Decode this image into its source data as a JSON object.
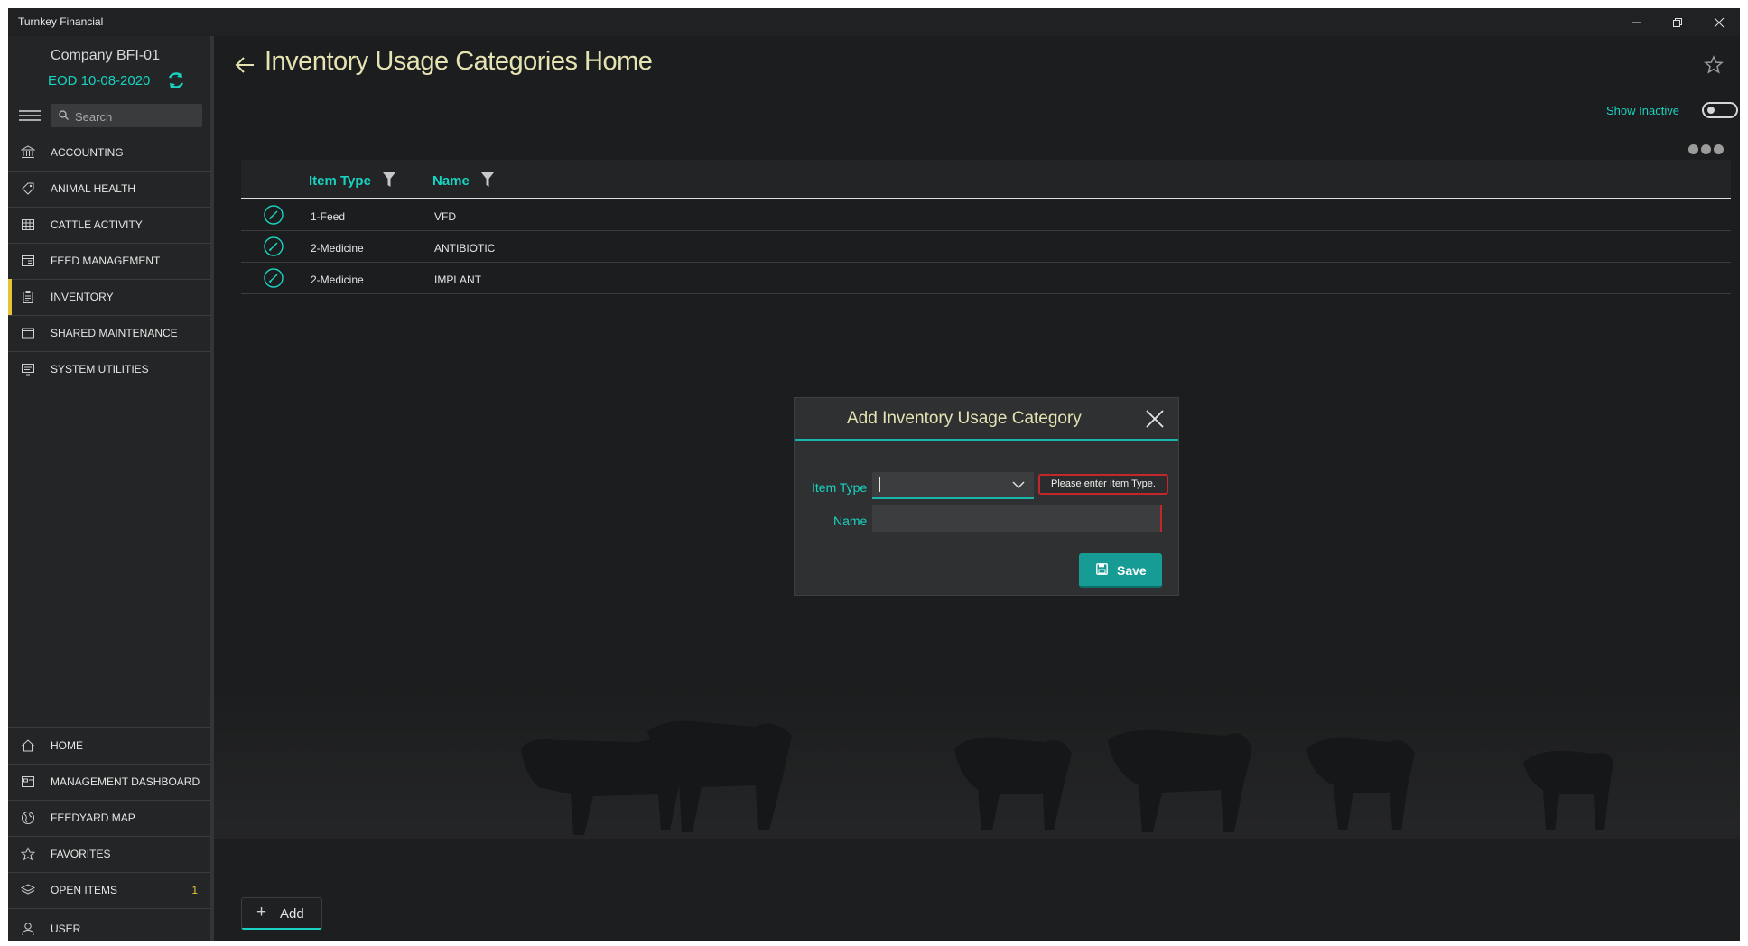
{
  "window": {
    "title": "Turnkey Financial"
  },
  "sidebar": {
    "company": "Company BFI-01",
    "eod": "EOD 10-08-2020",
    "search_placeholder": "Search",
    "top_items": [
      {
        "label": "ACCOUNTING",
        "icon": "bank-icon"
      },
      {
        "label": "ANIMAL HEALTH",
        "icon": "tag-icon"
      },
      {
        "label": "CATTLE ACTIVITY",
        "icon": "grid-icon"
      },
      {
        "label": "FEED MANAGEMENT",
        "icon": "tray-icon"
      },
      {
        "label": "INVENTORY",
        "icon": "clipboard-icon",
        "active": true
      },
      {
        "label": "SHARED MAINTENANCE",
        "icon": "window-icon"
      },
      {
        "label": "SYSTEM UTILITIES",
        "icon": "monitor-icon"
      }
    ],
    "bottom_items": [
      {
        "label": "HOME",
        "icon": "home-icon"
      },
      {
        "label": "MANAGEMENT DASHBOARD",
        "icon": "dashboard-icon"
      },
      {
        "label": "FEEDYARD MAP",
        "icon": "globe-icon"
      },
      {
        "label": "FAVORITES",
        "icon": "star-icon"
      },
      {
        "label": "OPEN ITEMS",
        "icon": "layers-icon",
        "badge": "1"
      },
      {
        "label": "USER",
        "icon": "user-icon"
      }
    ]
  },
  "page": {
    "title": "Inventory Usage Categories Home",
    "show_inactive": "Show Inactive"
  },
  "grid": {
    "columns": [
      "Item Type",
      "Name"
    ],
    "rows": [
      {
        "item_type": "1-Feed",
        "name": "VFD"
      },
      {
        "item_type": "2-Medicine",
        "name": "ANTIBIOTIC"
      },
      {
        "item_type": "2-Medicine",
        "name": "IMPLANT"
      }
    ]
  },
  "add_button": "Add",
  "dialog": {
    "title": "Add Inventory Usage Category",
    "item_type_label": "Item Type",
    "name_label": "Name",
    "item_type_value": "",
    "name_value": "",
    "validation_message": "Please enter Item Type.",
    "save_label": "Save"
  },
  "colors": {
    "accent": "#19d3c2",
    "title": "#e6e3b3",
    "active_marker": "#e6c337",
    "error": "#c3272b",
    "save": "#169c94"
  }
}
